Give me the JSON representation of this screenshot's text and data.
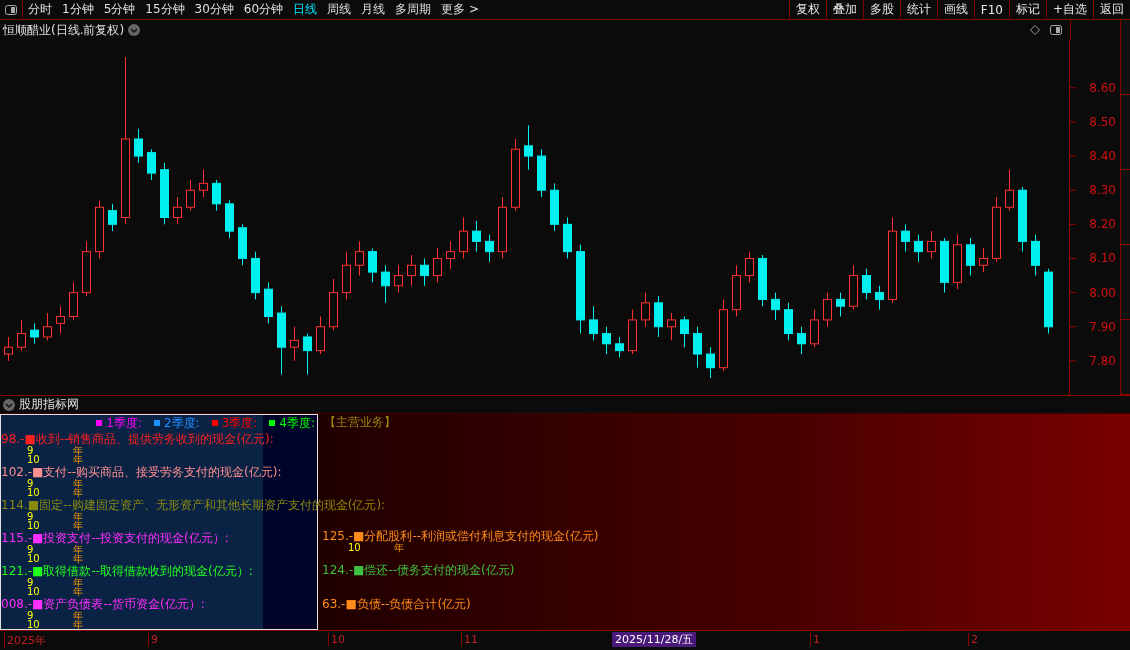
{
  "toolbar": {
    "periods": [
      {
        "label": "分时",
        "selected": false
      },
      {
        "label": "1分钟",
        "selected": false
      },
      {
        "label": "5分钟",
        "selected": false
      },
      {
        "label": "15分钟",
        "selected": false
      },
      {
        "label": "30分钟",
        "selected": false
      },
      {
        "label": "60分钟",
        "selected": false
      },
      {
        "label": "日线",
        "selected": true
      },
      {
        "label": "周线",
        "selected": false
      },
      {
        "label": "月线",
        "selected": false
      },
      {
        "label": "多周期",
        "selected": false
      },
      {
        "label": "更多 >",
        "selected": false
      }
    ],
    "actions": [
      "复权",
      "叠加",
      "多股",
      "统计",
      "画线",
      "F10",
      "标记",
      "+自选",
      "返回"
    ]
  },
  "chart": {
    "title": "恒顺醋业(日线.前复权)",
    "chart_data": {
      "type": "candlestick",
      "ylim": [
        7.7,
        8.74
      ],
      "yticks": [
        {
          "value": 8.6,
          "label": "8.60"
        },
        {
          "value": 8.5,
          "label": "8.50"
        },
        {
          "value": 8.4,
          "label": "8.40"
        },
        {
          "value": 8.3,
          "label": "8.30"
        },
        {
          "value": 8.2,
          "label": "8.20"
        },
        {
          "value": 8.1,
          "label": "8.10"
        },
        {
          "value": 8.0,
          "label": "8.00"
        },
        {
          "value": 7.9,
          "label": "7.90"
        },
        {
          "value": 7.8,
          "label": "7.80"
        }
      ],
      "ohlc": [
        [
          7.82,
          7.87,
          7.8,
          7.84
        ],
        [
          7.84,
          7.92,
          7.83,
          7.88
        ],
        [
          7.89,
          7.91,
          7.85,
          7.87
        ],
        [
          7.87,
          7.94,
          7.86,
          7.9
        ],
        [
          7.91,
          7.96,
          7.88,
          7.93
        ],
        [
          7.93,
          8.03,
          7.92,
          8.0
        ],
        [
          8.0,
          8.15,
          7.99,
          8.12
        ],
        [
          8.12,
          8.27,
          8.1,
          8.25
        ],
        [
          8.24,
          8.26,
          8.18,
          8.2
        ],
        [
          8.22,
          8.69,
          8.2,
          8.45
        ],
        [
          8.45,
          8.48,
          8.38,
          8.4
        ],
        [
          8.41,
          8.42,
          8.33,
          8.35
        ],
        [
          8.36,
          8.38,
          8.2,
          8.22
        ],
        [
          8.22,
          8.28,
          8.2,
          8.25
        ],
        [
          8.25,
          8.33,
          8.24,
          8.3
        ],
        [
          8.3,
          8.36,
          8.28,
          8.32
        ],
        [
          8.32,
          8.33,
          8.24,
          8.26
        ],
        [
          8.26,
          8.27,
          8.16,
          8.18
        ],
        [
          8.19,
          8.2,
          8.08,
          8.1
        ],
        [
          8.1,
          8.12,
          7.98,
          8.0
        ],
        [
          8.01,
          8.03,
          7.91,
          7.93
        ],
        [
          7.94,
          7.96,
          7.76,
          7.84
        ],
        [
          7.84,
          7.9,
          7.8,
          7.86
        ],
        [
          7.87,
          7.88,
          7.76,
          7.83
        ],
        [
          7.83,
          7.93,
          7.82,
          7.9
        ],
        [
          7.9,
          8.04,
          7.89,
          8.0
        ],
        [
          8.0,
          8.12,
          7.98,
          8.08
        ],
        [
          8.08,
          8.15,
          8.05,
          8.12
        ],
        [
          8.12,
          8.13,
          8.03,
          8.06
        ],
        [
          8.06,
          8.08,
          7.97,
          8.02
        ],
        [
          8.02,
          8.08,
          8.0,
          8.05
        ],
        [
          8.05,
          8.11,
          8.02,
          8.08
        ],
        [
          8.08,
          8.1,
          8.02,
          8.05
        ],
        [
          8.05,
          8.13,
          8.03,
          8.1
        ],
        [
          8.1,
          8.15,
          8.07,
          8.12
        ],
        [
          8.12,
          8.22,
          8.1,
          8.18
        ],
        [
          8.18,
          8.21,
          8.12,
          8.15
        ],
        [
          8.15,
          8.17,
          8.09,
          8.12
        ],
        [
          8.12,
          8.28,
          8.1,
          8.25
        ],
        [
          8.25,
          8.45,
          8.24,
          8.42
        ],
        [
          8.43,
          8.49,
          8.36,
          8.4
        ],
        [
          8.4,
          8.42,
          8.28,
          8.3
        ],
        [
          8.3,
          8.32,
          8.18,
          8.2
        ],
        [
          8.2,
          8.22,
          8.1,
          8.12
        ],
        [
          8.12,
          8.14,
          7.88,
          7.92
        ],
        [
          7.92,
          7.96,
          7.86,
          7.88
        ],
        [
          7.88,
          7.9,
          7.82,
          7.85
        ],
        [
          7.85,
          7.87,
          7.81,
          7.83
        ],
        [
          7.83,
          7.95,
          7.82,
          7.92
        ],
        [
          7.92,
          8.0,
          7.9,
          7.97
        ],
        [
          7.97,
          7.99,
          7.87,
          7.9
        ],
        [
          7.9,
          7.94,
          7.86,
          7.92
        ],
        [
          7.92,
          7.93,
          7.84,
          7.88
        ],
        [
          7.88,
          7.9,
          7.78,
          7.82
        ],
        [
          7.82,
          7.84,
          7.75,
          7.78
        ],
        [
          7.78,
          7.98,
          7.77,
          7.95
        ],
        [
          7.95,
          8.08,
          7.93,
          8.05
        ],
        [
          8.05,
          8.12,
          8.03,
          8.1
        ],
        [
          8.1,
          8.11,
          7.96,
          7.98
        ],
        [
          7.98,
          8.0,
          7.92,
          7.95
        ],
        [
          7.95,
          7.97,
          7.86,
          7.88
        ],
        [
          7.88,
          7.9,
          7.82,
          7.85
        ],
        [
          7.85,
          7.95,
          7.84,
          7.92
        ],
        [
          7.92,
          8.0,
          7.9,
          7.98
        ],
        [
          7.98,
          8.0,
          7.93,
          7.96
        ],
        [
          7.96,
          8.08,
          7.95,
          8.05
        ],
        [
          8.05,
          8.07,
          7.98,
          8.0
        ],
        [
          8.0,
          8.02,
          7.95,
          7.98
        ],
        [
          7.98,
          8.22,
          7.97,
          8.18
        ],
        [
          8.18,
          8.2,
          8.12,
          8.15
        ],
        [
          8.15,
          8.17,
          8.09,
          8.12
        ],
        [
          8.12,
          8.18,
          8.1,
          8.15
        ],
        [
          8.15,
          8.16,
          8.0,
          8.03
        ],
        [
          8.03,
          8.17,
          8.01,
          8.14
        ],
        [
          8.14,
          8.16,
          8.05,
          8.08
        ],
        [
          8.08,
          8.13,
          8.06,
          8.1
        ],
        [
          8.1,
          8.28,
          8.09,
          8.25
        ],
        [
          8.25,
          8.36,
          8.24,
          8.3
        ],
        [
          8.3,
          8.31,
          8.12,
          8.15
        ],
        [
          8.15,
          8.17,
          8.05,
          8.08
        ],
        [
          8.06,
          8.07,
          7.88,
          7.9
        ]
      ]
    }
  },
  "indicator": {
    "title": "股朋指标网",
    "legend": [
      {
        "label": "1季度:",
        "color": "#ff00ff"
      },
      {
        "label": "2季度:",
        "color": "#1e90ff"
      },
      {
        "label": "3季度:",
        "color": "#ff0000"
      },
      {
        "label": "4季度:",
        "color": "#00ff00"
      }
    ],
    "main_business": "【主营业务】",
    "rows": [
      {
        "left": {
          "label": "98.-■收到--销售商品、提供劳务收到的现金(亿元):",
          "color": "#ff2020",
          "values": [
            "9",
            "10"
          ],
          "units": [
            "年",
            "年"
          ]
        }
      },
      {
        "left": {
          "label": "102.-■支付--购买商品、接受劳务支付的现金(亿元):",
          "color": "#ff9090",
          "values": [
            "9",
            "10"
          ],
          "units": [
            "年",
            "年"
          ]
        }
      },
      {
        "left": {
          "label": "114.■固定--购建固定资产、无形资产和其他长期资产支付的现金(亿元):",
          "color": "#8a8a10",
          "values": [
            "9",
            "10"
          ],
          "units": [
            "年",
            "年"
          ]
        }
      },
      {
        "left": {
          "label": "115.-■投资支付--投资支付的现金(亿元）:",
          "color": "#ff30ff",
          "values": [
            "9",
            "10"
          ],
          "units": [
            "年",
            "年"
          ]
        },
        "right": {
          "label": "125.-■分配股利--利润或偿付利息支付的现金(亿元)",
          "color": "#ff8c1a",
          "values": [
            "10"
          ],
          "units": [
            "年"
          ]
        }
      },
      {
        "left": {
          "label": "121.-■取得借款--取得借款收到的现金(亿元）:",
          "color": "#20ff20",
          "values": [
            "9",
            "10"
          ],
          "units": [
            "年",
            "年"
          ]
        },
        "right": {
          "label": "124.-■偿还--债务支付的现金(亿元)",
          "color": "#40c040"
        }
      },
      {
        "left": {
          "label": "008.-■资产负债表--货币资金(亿元）:",
          "color": "#ff30ff",
          "values": [
            "9",
            "10"
          ],
          "units": [
            "年",
            "年"
          ]
        },
        "right": {
          "label": "63.-■负债--负债合计(亿元)",
          "color": "#ff8c1a"
        }
      }
    ]
  },
  "time_axis": {
    "labels": [
      "2025年",
      "9",
      "10",
      "11",
      "1",
      "2"
    ],
    "cursor": "2025/11/28/五"
  }
}
